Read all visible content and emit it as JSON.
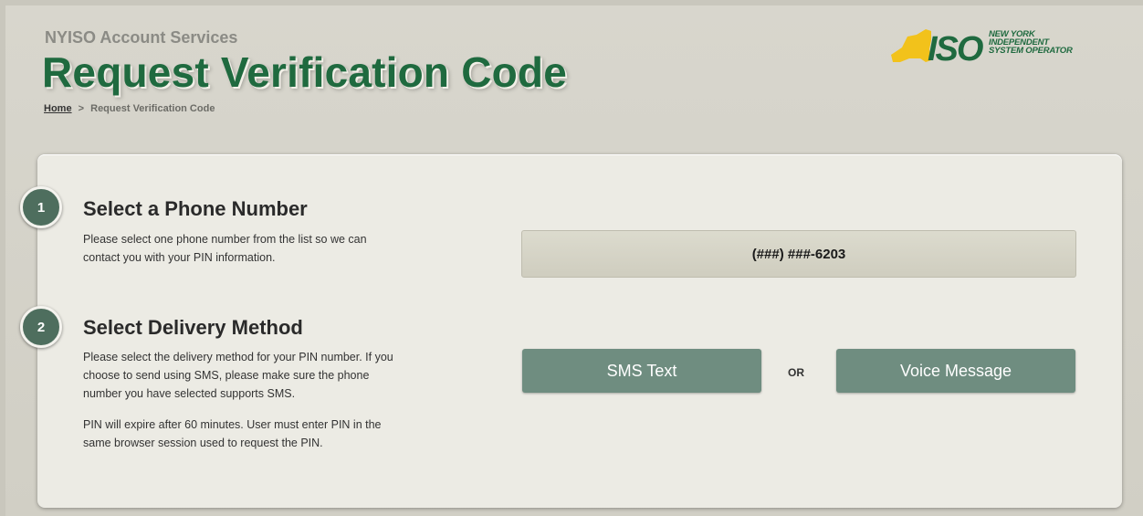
{
  "header": {
    "app_name": "NYISO Account Services",
    "page_title": "Request Verification Code",
    "breadcrumb": {
      "home": "Home",
      "separator": ">",
      "current": "Request Verification Code"
    },
    "logo": {
      "mark": "ISO",
      "line1": "NEW YORK",
      "line2": "INDEPENDENT",
      "line3": "SYSTEM OPERATOR"
    }
  },
  "step1": {
    "number": "1",
    "title": "Select a Phone Number",
    "description_line1": "Please select one phone number from the list so we can",
    "description_line2": "contact you with your PIN information.",
    "phone_options": [
      "(###) ###-6203"
    ]
  },
  "step2": {
    "number": "2",
    "title": "Select Delivery Method",
    "description_line1": "Please select the delivery method for your PIN number. If you",
    "description_line2": "choose to send using SMS, please make sure the phone",
    "description_line3": "number you have selected supports SMS.",
    "note_line1": "PIN will expire after 60 minutes. User must enter PIN in the",
    "note_line2": "same browser session used to request the PIN.",
    "sms_label": "SMS Text",
    "or_label": "OR",
    "voice_label": "Voice Message"
  },
  "colors": {
    "brand_green": "#1f6a3f",
    "logo_yellow": "#f2c21b",
    "badge": "#4e6e5e",
    "button": "#6f8d80"
  }
}
